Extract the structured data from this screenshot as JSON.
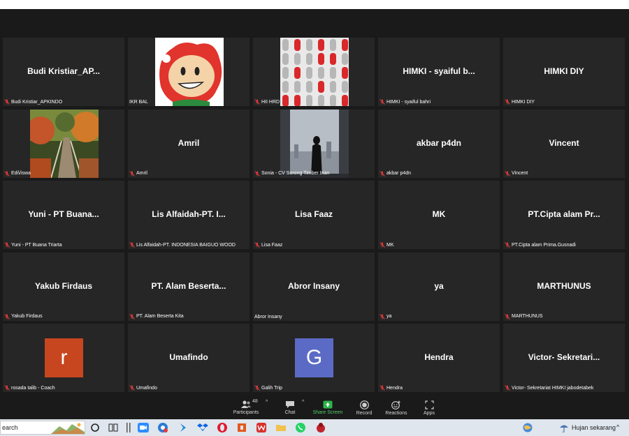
{
  "participants": [
    {
      "name": "Budi  Kristiar_AP...",
      "label": "Budi Kristiar_APKINDO",
      "muted": true,
      "pic": null
    },
    {
      "name": "",
      "label": "IKR BAL",
      "muted": false,
      "pic": "cartoon"
    },
    {
      "name": "",
      "label": "HII HRD",
      "muted": true,
      "pic": "pattern"
    },
    {
      "name": "HIMKI - syaiful b...",
      "label": "HIMKI - syaiful bahri",
      "muted": true,
      "pic": null
    },
    {
      "name": "HIMKI DIY",
      "label": "HIMKI DIY",
      "muted": true,
      "pic": null
    },
    {
      "name": "",
      "label": "Edi\\/iswa",
      "muted": true,
      "pic": "forest"
    },
    {
      "name": "Amril",
      "label": "Amril",
      "muted": true,
      "pic": null
    },
    {
      "name": "",
      "label": "Sonia - CV Sorong Timber Irian",
      "muted": true,
      "pic": "city"
    },
    {
      "name": "akbar p4dn",
      "label": "akbar p4dn",
      "muted": true,
      "pic": null
    },
    {
      "name": "Vincent",
      "label": "Vincent",
      "muted": true,
      "pic": null
    },
    {
      "name": "Yuni - PT Buana...",
      "label": "Yuni - PT Buana Triarta",
      "muted": true,
      "pic": null
    },
    {
      "name": "Lis Alfaidah-PT. I...",
      "label": "Lis Alfaidah-PT. INDONESIA BAIGUO WOOD",
      "muted": true,
      "pic": null
    },
    {
      "name": "Lisa Faaz",
      "label": "Lisa Faaz",
      "muted": true,
      "pic": null
    },
    {
      "name": "MK",
      "label": "MK",
      "muted": true,
      "pic": null
    },
    {
      "name": "PT.Cipta alam Pr...",
      "label": "PT.Cipta alam Prima.Gusnadi",
      "muted": true,
      "pic": null
    },
    {
      "name": "Yakub Firdaus",
      "label": "Yakub Firdaus",
      "muted": true,
      "pic": null
    },
    {
      "name": "PT. Alam Beserta...",
      "label": "PT. Alam Beserta Kita",
      "muted": true,
      "pic": null
    },
    {
      "name": "Abror Insany",
      "label": "Abror Insany",
      "muted": false,
      "pic": null
    },
    {
      "name": "ya",
      "label": "ya",
      "muted": true,
      "pic": null
    },
    {
      "name": "MARTHUNUS",
      "label": "MARTHUNUS",
      "muted": true,
      "pic": null
    },
    {
      "name": "",
      "label": "rosada talib - Coach",
      "muted": true,
      "pic": "letter-r"
    },
    {
      "name": "Umafindo",
      "label": "Umafindo",
      "muted": true,
      "pic": null
    },
    {
      "name": "",
      "label": "Galih Trip",
      "muted": true,
      "pic": "letter-g"
    },
    {
      "name": "Hendra",
      "label": "Hendra",
      "muted": true,
      "pic": null
    },
    {
      "name": "Victor- Sekretari...",
      "label": "Victor- Sekretariat HIMKI jabodetabek",
      "muted": true,
      "pic": null
    }
  ],
  "avatars": {
    "r": "r",
    "g": "G",
    "r_color": "#c7461f",
    "g_color": "#5b6bc5"
  },
  "toolbar": {
    "participants_label": "Participants",
    "participants_count": "48",
    "chat_label": "Chat",
    "share_label": "Share Screen",
    "record_label": "Record",
    "reactions_label": "Reactions",
    "apps_label": "Apps",
    "caret": "^"
  },
  "taskbar": {
    "search_text": "earch",
    "weather_text": "Hujan sekarang",
    "caret": "^"
  },
  "colors": {
    "mute": "#e03b3b",
    "share": "#2fb34a",
    "tile": "#262626",
    "bg": "#1a1a1a"
  }
}
